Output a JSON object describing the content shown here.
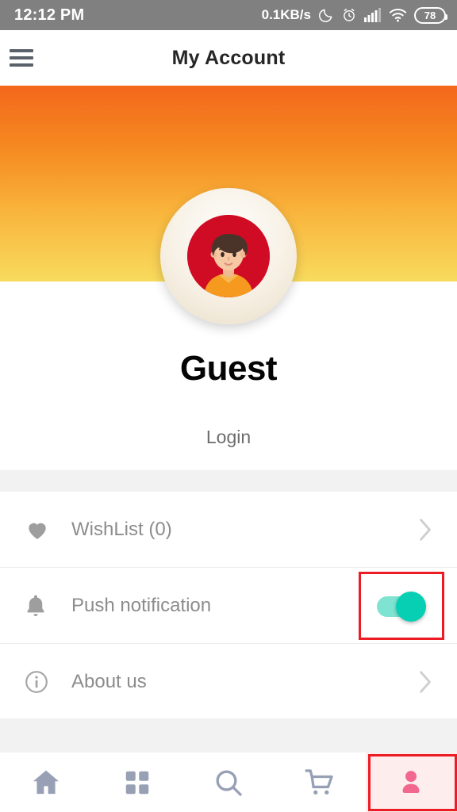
{
  "statusbar": {
    "time": "12:12 PM",
    "network_speed": "0.1KB/s",
    "icons": [
      "moon-icon",
      "alarm-clock-icon",
      "signal-bars-icon",
      "wifi-icon"
    ],
    "battery_level": "78"
  },
  "appbar": {
    "menu_icon": "hamburger-menu-icon",
    "title": "My Account"
  },
  "profile": {
    "avatar_icon": "user-avatar-boy",
    "name": "Guest",
    "login_label": "Login",
    "banner_color_top": "#F4671C",
    "banner_color_bottom": "#F8DB5D"
  },
  "menu": {
    "items": [
      {
        "icon": "heart-icon",
        "label": "WishList (0)",
        "accessory": "chevron-right-icon"
      },
      {
        "icon": "bell-icon",
        "label": "Push notification",
        "accessory": "toggle-switch",
        "toggle_on": true,
        "toggle_color": "#06CFB4",
        "highlighted": true
      },
      {
        "icon": "info-circle-icon",
        "label": "About us",
        "accessory": "chevron-right-icon"
      }
    ]
  },
  "bottomnav": {
    "items": [
      {
        "icon": "home-icon",
        "active": false
      },
      {
        "icon": "grid-categories-icon",
        "active": false
      },
      {
        "icon": "search-icon",
        "active": false
      },
      {
        "icon": "shopping-cart-icon",
        "active": false
      },
      {
        "icon": "person-profile-icon",
        "active": true
      }
    ],
    "active_color": "#F2678E",
    "inactive_color": "#97A0B5",
    "highlight_color": "#ED1C24"
  }
}
